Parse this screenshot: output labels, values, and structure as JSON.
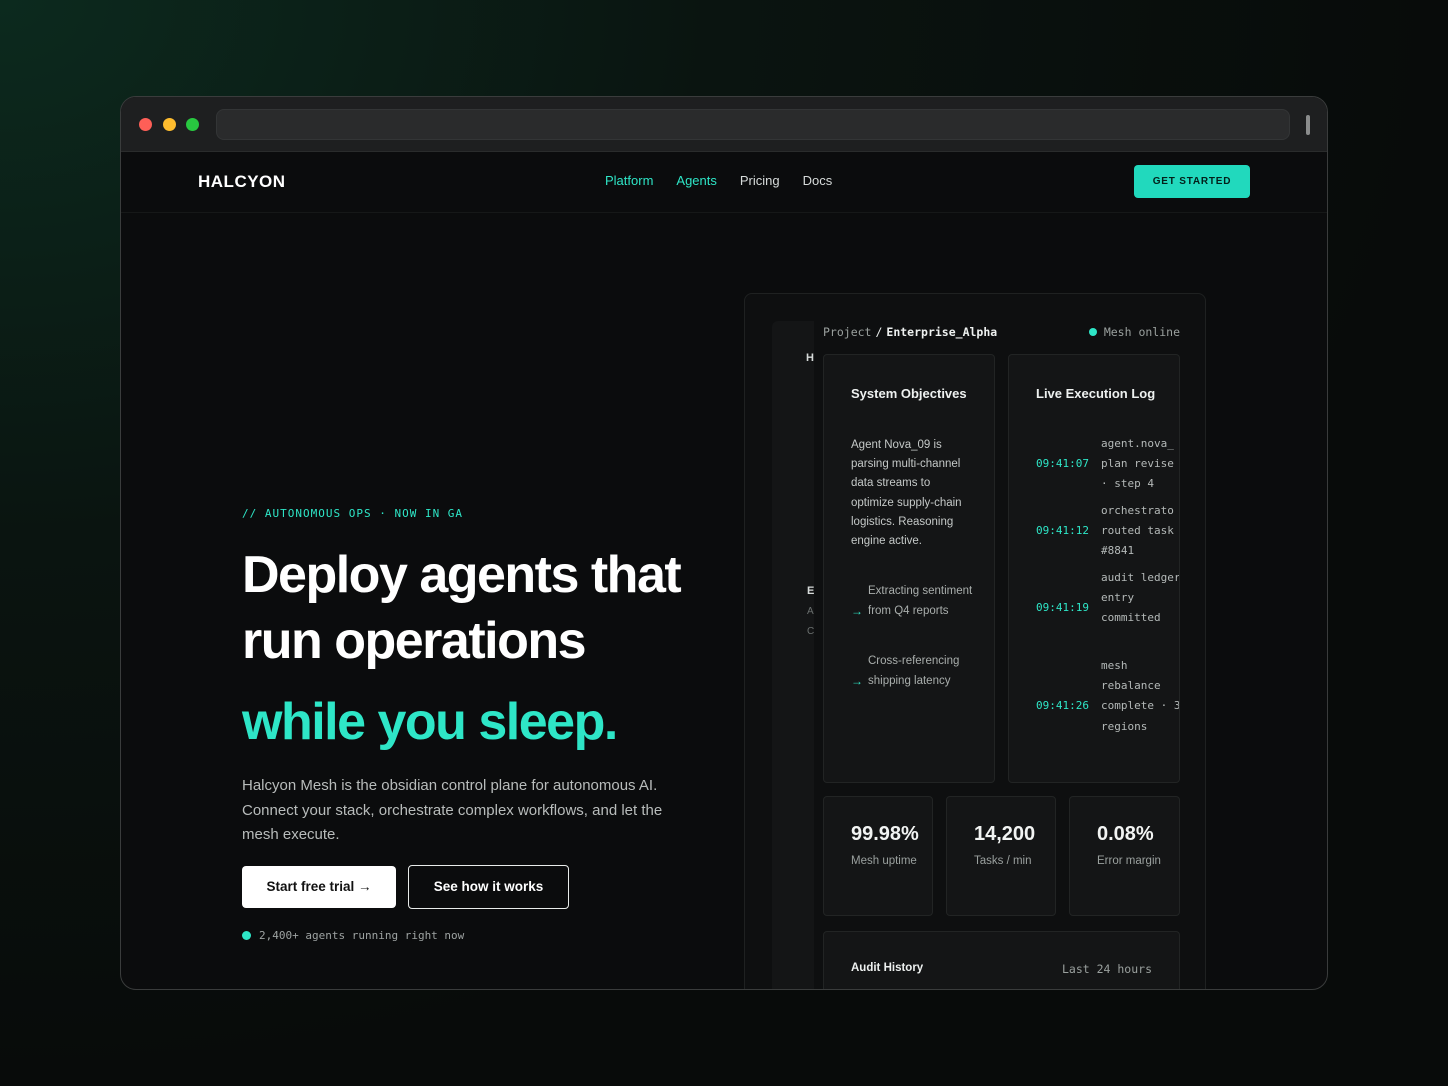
{
  "browser": {
    "url": ""
  },
  "nav": {
    "logo": "HALCYON",
    "links": [
      {
        "label": "Platform",
        "active": true
      },
      {
        "label": "Agents",
        "active": true
      },
      {
        "label": "Pricing",
        "active": false
      },
      {
        "label": "Docs",
        "active": false
      }
    ],
    "cta": "GET STARTED"
  },
  "hero": {
    "eyebrow": "// AUTONOMOUS OPS · NOW IN GA",
    "headline_line1": "Deploy agents that",
    "headline_line2": "run operations",
    "headline_accent": "while you sleep.",
    "lead": "Halcyon Mesh is the obsidian control plane for autonomous AI. Connect your stack, orchestrate complex workflows, and let the mesh execute.",
    "primary_button": "Start free trial →",
    "secondary_button": "See how it works",
    "status": "2,400+ agents running right now"
  },
  "dashboard": {
    "side_glyphs": [
      "H",
      "E",
      "A",
      "C"
    ],
    "breadcrumb_project": "Project",
    "breadcrumb_sep": "/",
    "breadcrumb_name": "Enterprise_Alpha",
    "mesh_status": "Mesh online",
    "objectives": {
      "title": "System Objectives",
      "text": "Agent Nova_09 is parsing multi-channel data streams to optimize supply-chain logistics. Reasoning engine active.",
      "steps": [
        "Extracting sentiment from Q4 reports",
        "Cross-referencing shipping latency"
      ]
    },
    "log": {
      "title": "Live Execution Log",
      "entries": [
        {
          "time": "09:41:07",
          "message": "agent.nova_ plan revise · step 4"
        },
        {
          "time": "09:41:12",
          "message": "orchestrato routed task #8841"
        },
        {
          "time": "09:41:19",
          "message": "audit ledger entry committed"
        },
        {
          "time": "09:41:26",
          "message": "mesh rebalance complete · 3 regions"
        }
      ]
    },
    "stats": [
      {
        "value": "99.98%",
        "label": "Mesh uptime"
      },
      {
        "value": "14,200",
        "label": "Tasks / min"
      },
      {
        "value": "0.08%",
        "label": "Error margin"
      }
    ],
    "audit": {
      "title": "Audit History",
      "range": "Last 24 hours"
    }
  },
  "colors": {
    "accent": "#2ee6c7",
    "cta_bg": "#21d9bd",
    "background": "#0b0c0d"
  }
}
